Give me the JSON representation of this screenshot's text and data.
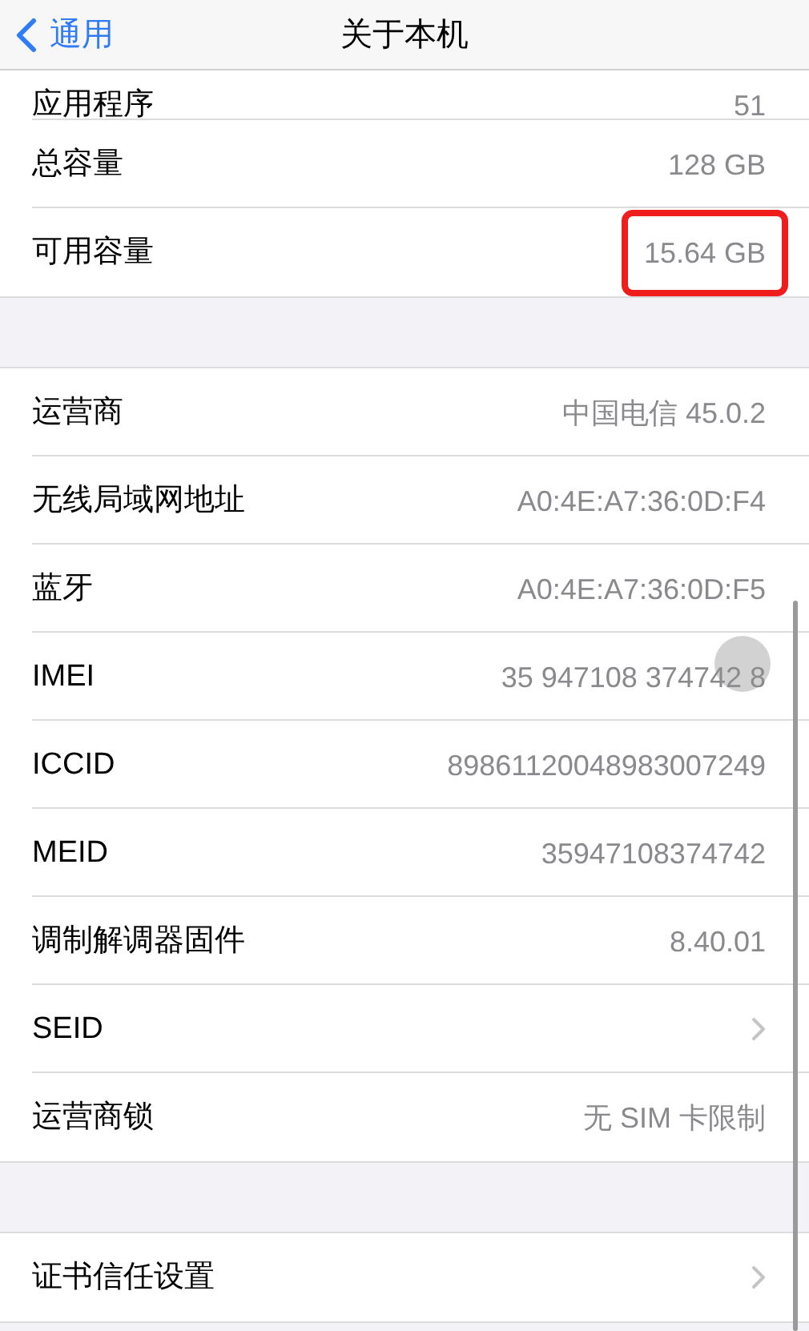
{
  "nav": {
    "back": "通用",
    "title": "关于本机"
  },
  "sections": [
    {
      "rows": [
        {
          "kind": "value",
          "label": "应用程序",
          "value": "51",
          "highlighted": false
        },
        {
          "kind": "value",
          "label": "总容量",
          "value": "128 GB",
          "highlighted": false
        },
        {
          "kind": "value",
          "label": "可用容量",
          "value": "15.64 GB",
          "highlighted": true
        }
      ]
    },
    {
      "rows": [
        {
          "kind": "value",
          "label": "运营商",
          "value": "中国电信 45.0.2",
          "highlighted": false
        },
        {
          "kind": "value",
          "label": "无线局域网地址",
          "value": "A0:4E:A7:36:0D:F4",
          "highlighted": false
        },
        {
          "kind": "value",
          "label": "蓝牙",
          "value": "A0:4E:A7:36:0D:F5",
          "highlighted": false
        },
        {
          "kind": "value",
          "label": "IMEI",
          "value": "35 947108 374742 8",
          "highlighted": false
        },
        {
          "kind": "value",
          "label": "ICCID",
          "value": "89861120048983007249",
          "highlighted": false
        },
        {
          "kind": "value",
          "label": "MEID",
          "value": "35947108374742",
          "highlighted": false
        },
        {
          "kind": "value",
          "label": "调制解调器固件",
          "value": "8.40.01",
          "highlighted": false
        },
        {
          "kind": "link",
          "label": "SEID"
        },
        {
          "kind": "value",
          "label": "运营商锁",
          "value": "无 SIM 卡限制",
          "highlighted": false
        }
      ]
    },
    {
      "rows": [
        {
          "kind": "link",
          "label": "证书信任设置"
        }
      ]
    }
  ]
}
